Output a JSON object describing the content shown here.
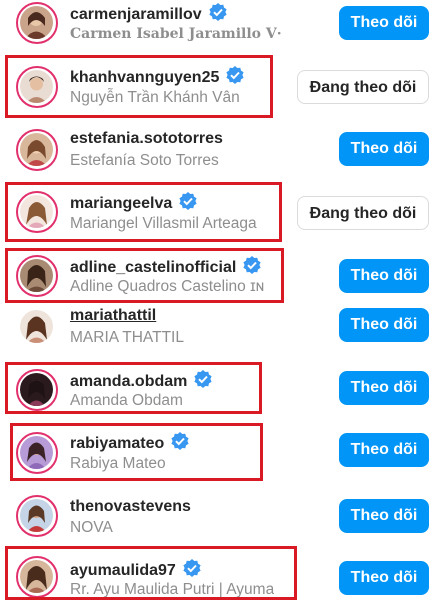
{
  "colors": {
    "accent": "#0095f6",
    "highlight": "#d91a25",
    "ring": "#e1306c",
    "verified": "#3897f0"
  },
  "accounts": [
    {
      "username": "carmenjaramillov",
      "full_name": "Carmen Isabel Jaramillo V·",
      "verified": true,
      "button": "Theo dõi"
    },
    {
      "username": "khanhvannguyen25",
      "full_name": "Nguyễn Trần Khánh Vân",
      "verified": true,
      "button": "Đang theo dõi"
    },
    {
      "username": "estefania.sototorres",
      "full_name": "Estefanía Soto Torres",
      "verified": false,
      "button": "Theo dõi"
    },
    {
      "username": "mariangeelva",
      "full_name": "Mariangel Villasmil Arteaga",
      "verified": true,
      "button": "Đang theo dõi"
    },
    {
      "username": "adline_castelinofficial",
      "full_name": "Adline Quadros Castelino ɪɴ",
      "verified": true,
      "button": "Theo dõi"
    },
    {
      "username": "mariathattil",
      "full_name": "MARIA THATTIL",
      "verified": false,
      "button": "Theo dõi"
    },
    {
      "username": "amanda.obdam",
      "full_name": "Amanda Obdam",
      "verified": true,
      "button": "Theo dõi"
    },
    {
      "username": "rabiyamateo",
      "full_name": "Rabiya Mateo",
      "verified": true,
      "button": "Theo dõi"
    },
    {
      "username": "thenovastevens",
      "full_name": "NOVA",
      "verified": false,
      "button": "Theo dõi"
    },
    {
      "username": "ayumaulida97",
      "full_name": "Rr. Ayu Maulida Putri | Ayuma",
      "verified": true,
      "button": "Theo dõi"
    }
  ]
}
